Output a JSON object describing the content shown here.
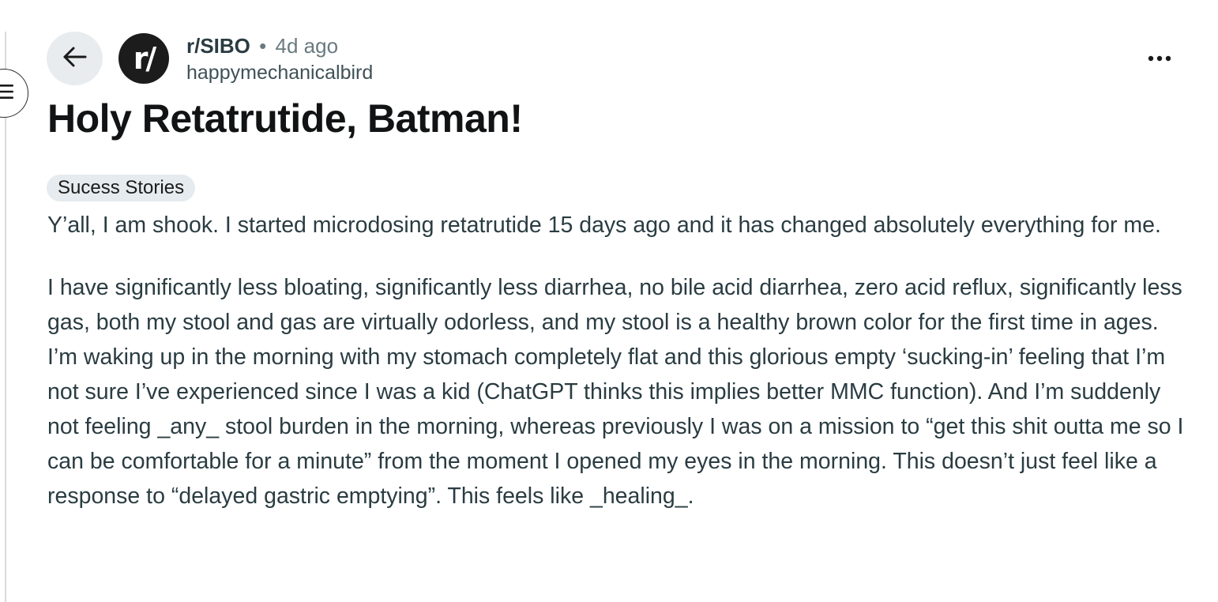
{
  "post": {
    "subreddit": "r/SIBO",
    "separator": "•",
    "age": "4d ago",
    "author": "happymechanicalbird",
    "avatar_glyph": "r/",
    "title": "Holy Retatrutide, Batman!",
    "flair": "Sucess Stories",
    "paragraphs": [
      "Y’all, I am shook. I started microdosing retatrutide 15 days ago and it has changed absolutely everything for me.",
      "I have significantly less bloating, significantly less diarrhea, no bile acid diarrhea, zero acid reflux, significantly less gas, both my stool and gas are virtually odorless, and my stool is a healthy brown color for the first time in ages. I’m waking up in the morning with my stomach completely flat and this glorious empty ‘sucking-in’ feeling that I’m not sure I’ve experienced since I was a kid (ChatGPT thinks this implies better MMC function). And I’m suddenly not feeling _any_ stool burden in the morning, whereas previously I was on a mission to “get this shit outta me so I can be comfortable for a minute” from the moment I opened my eyes in the morning. This doesn’t just feel like a response to “delayed gastric emptying”. This feels like _healing_."
    ]
  },
  "icons": {
    "menu": "hamburger-menu-icon",
    "back": "arrow-left-icon",
    "more": "more-horizontal-icon"
  },
  "colors": {
    "back_button_bg": "#e9ecee",
    "avatar_bg": "#1c1c1c",
    "flair_bg": "#e5ebee",
    "body_text": "#2a3c42",
    "meta_text": "#6a7a80"
  }
}
